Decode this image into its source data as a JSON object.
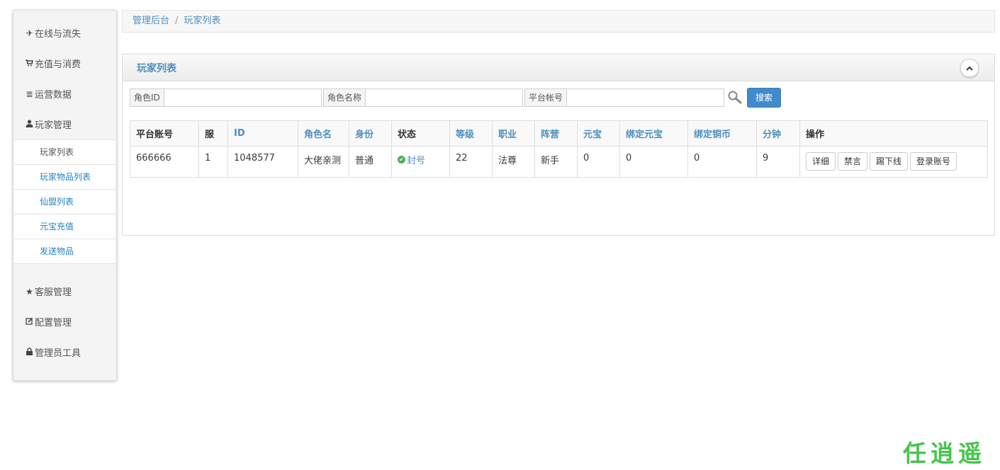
{
  "sidebar": {
    "items": [
      {
        "label": "在线与流失",
        "icon": "plane-icon"
      },
      {
        "label": "充值与消费",
        "icon": "cart-icon"
      },
      {
        "label": "运营数据",
        "icon": "list-icon"
      },
      {
        "label": "玩家管理",
        "icon": "user-icon"
      },
      {
        "label": "客服管理",
        "icon": "star-icon"
      },
      {
        "label": "配置管理",
        "icon": "edit-icon"
      },
      {
        "label": "管理员工具",
        "icon": "lock-icon"
      }
    ],
    "submenu": [
      "玩家列表",
      "玩家物品列表",
      "仙盟列表",
      "元宝充值",
      "发送物品"
    ]
  },
  "breadcrumb": {
    "home": "管理后台",
    "separator": "/",
    "current": "玩家列表"
  },
  "panel": {
    "title": "玩家列表"
  },
  "search": {
    "role_id_label": "角色ID",
    "role_name_label": "角色名称",
    "platform_account_label": "平台帐号",
    "button": "搜索"
  },
  "table": {
    "headers": [
      "平台账号",
      "服",
      "ID",
      "角色名",
      "身份",
      "状态",
      "等级",
      "职业",
      "阵营",
      "元宝",
      "绑定元宝",
      "绑定铜币",
      "分钟",
      "操作"
    ],
    "rows": [
      {
        "platform_account": "666666",
        "server": "1",
        "id": "1048577",
        "name": "大佬亲测",
        "identity": "普通",
        "status": "封号",
        "level": "22",
        "job": "法尊",
        "camp": "新手",
        "yuanbao": "0",
        "bind_yuanbao": "0",
        "bind_copper": "0",
        "minutes": "9",
        "actions": [
          "详细",
          "禁言",
          "踢下线",
          "登录账号"
        ]
      }
    ]
  },
  "watermark": "任逍遥",
  "colors": {
    "accent": "#4c8fbd",
    "button": "#428bca",
    "status_ok": "#4caf50",
    "watermark": "#47c44d"
  }
}
